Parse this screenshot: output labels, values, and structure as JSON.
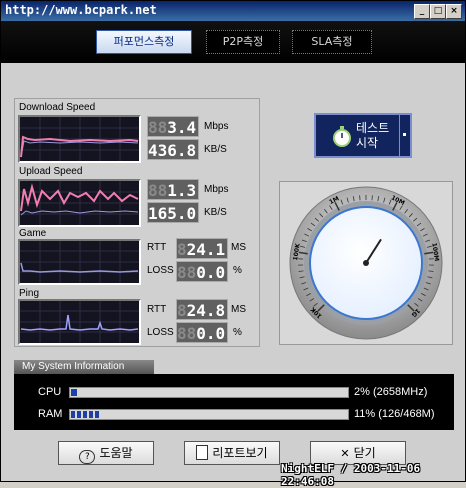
{
  "window": {
    "title": "http://www.bcpark.net",
    "controls": {
      "minimize": "_",
      "maximize": "□",
      "close": "×"
    }
  },
  "tabs": [
    {
      "label": "퍼포먼스측정",
      "active": true
    },
    {
      "label": "P2P측정",
      "active": false
    },
    {
      "label": "SLA측정",
      "active": false
    }
  ],
  "performance": {
    "download": {
      "label": "Download Speed",
      "mbps": "3.4",
      "mbps_dim": "88",
      "kbs": "436.8",
      "kbs_dim": "",
      "unit1": "Mbps",
      "unit2": "KB/S"
    },
    "upload": {
      "label": "Upload Speed",
      "mbps": "1.3",
      "mbps_dim": "88",
      "kbs": "165.0",
      "kbs_dim": "",
      "unit1": "Mbps",
      "unit2": "KB/S"
    },
    "game": {
      "label": "Game",
      "rtt_label": "RTT",
      "rtt": "24.1",
      "rtt_dim": "8",
      "rtt_unit": "MS",
      "loss_label": "LOSS",
      "loss": "0.0",
      "loss_dim": "88",
      "loss_unit": "%"
    },
    "ping": {
      "label": "Ping",
      "rtt_label": "RTT",
      "rtt": "24.8",
      "rtt_dim": "8",
      "rtt_unit": "MS",
      "loss_label": "LOSS",
      "loss": "0.0",
      "loss_dim": "88",
      "loss_unit": "%"
    }
  },
  "start_button": {
    "line1": "테스트",
    "line2": "시작",
    "icon": "stopwatch-icon"
  },
  "gauge": {
    "labels": [
      "10K",
      "100K",
      "1M",
      "10M",
      "100M",
      "1G"
    ],
    "needle_fraction": 0.62
  },
  "system_info": {
    "title": "My System Information",
    "cpu": {
      "label": "CPU",
      "value": "2% (2658MHz)",
      "percent": 2
    },
    "ram": {
      "label": "RAM",
      "value": "11% (126/468M)",
      "percent": 11
    }
  },
  "buttons": {
    "help": {
      "label": "도움말",
      "icon": "help-icon"
    },
    "report": {
      "label": "리포트보기",
      "icon": "report-icon"
    },
    "close": {
      "label": "닫기",
      "icon": "close-icon"
    }
  },
  "footer": "NightELF / 2003-11-06 22:46:08",
  "colors": {
    "accent": "#12245e",
    "graph_bg": "#141420",
    "download_line": "#f07fb0",
    "upload_line": "#f07fb0",
    "game_line": "#9a9adf",
    "ping_line": "#a0a0ff"
  }
}
